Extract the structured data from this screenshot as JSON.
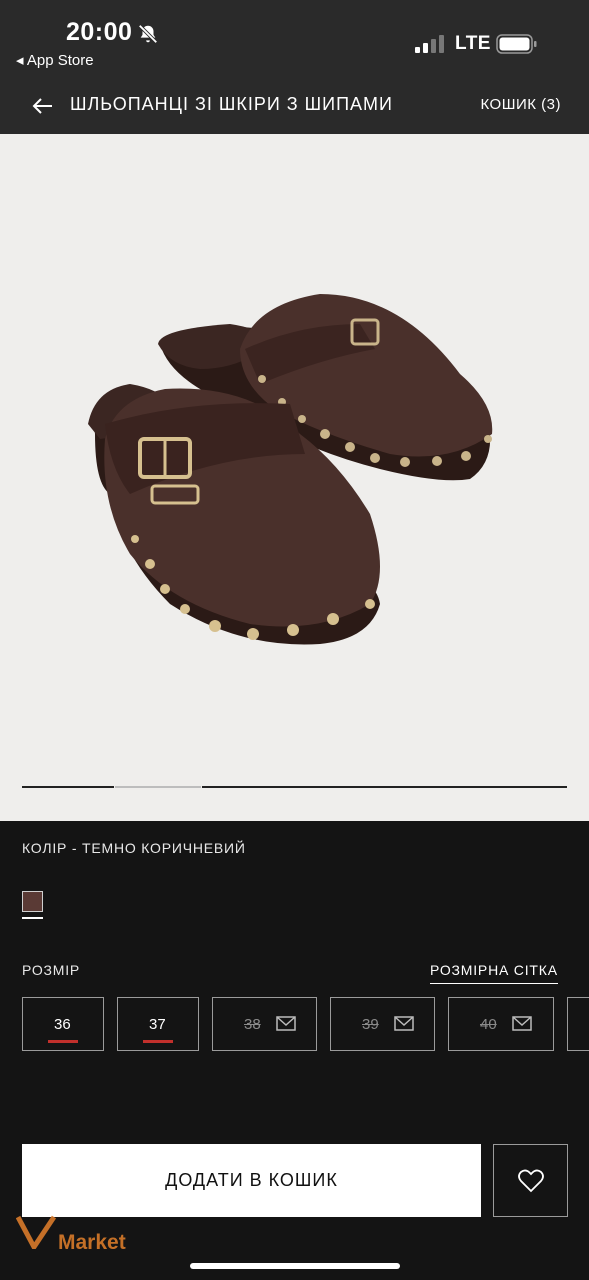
{
  "status_bar": {
    "time": "20:00",
    "back_app": "App Store",
    "network": "LTE",
    "icons": [
      "bell-muted-icon",
      "signal-icon",
      "battery-icon"
    ]
  },
  "nav": {
    "title": "ШЛЬОПАНЦІ ЗІ ШКІРИ З ШИПАМИ",
    "cart": "КОШИК (3)"
  },
  "product": {
    "color_label": "КОЛІР - ТЕМНО КОРИЧНЕВИЙ",
    "swatch_color": "#5a3a35",
    "size_label": "РОЗМІР",
    "size_chart": "РОЗМІРНА СІТКА",
    "sizes": [
      {
        "label": "36",
        "available": true,
        "low_stock": true
      },
      {
        "label": "37",
        "available": true,
        "low_stock": true
      },
      {
        "label": "38",
        "available": false
      },
      {
        "label": "39",
        "available": false
      },
      {
        "label": "40",
        "available": false
      }
    ]
  },
  "actions": {
    "add_to_cart": "ДОДАТИ В КОШИК"
  },
  "watermark": "Market",
  "colors": {
    "background": "#141414",
    "header": "#2a2a2a",
    "low_stock": "#c2302c"
  }
}
